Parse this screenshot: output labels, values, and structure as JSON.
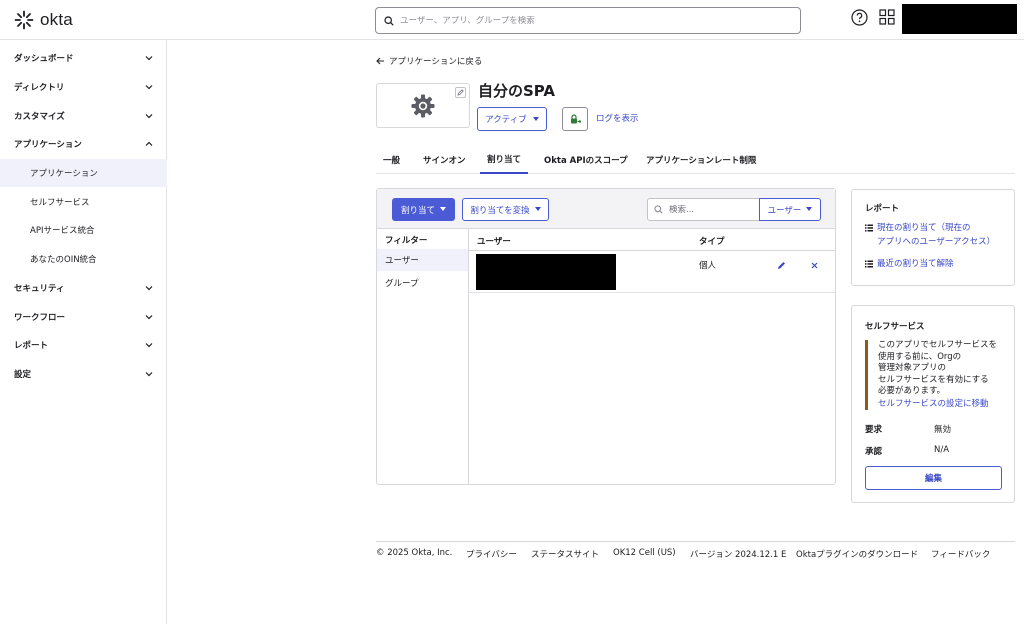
{
  "brand": {
    "name": "okta"
  },
  "header": {
    "search_placeholder": "ユーザー、アプリ、グループを検索"
  },
  "sidebar": {
    "items": [
      {
        "label": "ダッシュボード"
      },
      {
        "label": "ディレクトリ"
      },
      {
        "label": "カスタマイズ"
      },
      {
        "label": "アプリケーション",
        "expanded": true
      },
      {
        "label": "セキュリティ"
      },
      {
        "label": "ワークフロー"
      },
      {
        "label": "レポート"
      },
      {
        "label": "設定"
      }
    ],
    "sub_items": [
      {
        "label": "アプリケーション",
        "active": true
      },
      {
        "label": "セルフサービス"
      },
      {
        "label": "APIサービス統合"
      },
      {
        "label": "あなたのOIN統合"
      }
    ]
  },
  "main": {
    "back_link": "アプリケーションに戻る",
    "app_title": "自分のSPA",
    "status_label": "アクティブ",
    "log_link": "ログを表示",
    "tabs": [
      {
        "label": "一般"
      },
      {
        "label": "サインオン"
      },
      {
        "label": "割り当て",
        "active": true
      },
      {
        "label": "Okta APIのスコープ"
      },
      {
        "label": "アプリケーションレート制限"
      }
    ],
    "toolbar": {
      "assign_label": "割り当て",
      "convert_label": "割り当てを変換",
      "search_placeholder": "検索...",
      "scope_label": "ユーザー"
    },
    "filter": {
      "heading": "フィルター",
      "items": [
        {
          "label": "ユーザー",
          "active": true
        },
        {
          "label": "グループ"
        }
      ]
    },
    "table": {
      "headers": {
        "user": "ユーザー",
        "type": "タイプ"
      },
      "rows": [
        {
          "type": "個人"
        }
      ]
    }
  },
  "reports_card": {
    "title": "レポート",
    "link1_line1": "現在の割り当て（現在の",
    "link1_line2": "アプリへのユーザーアクセス）",
    "link2": "最近の割り当て解除"
  },
  "self_service_card": {
    "title": "セルフサービス",
    "notice_lines": [
      "このアプリでセルフサービスを",
      "使用する前に、Orgの",
      "管理対象アプリの",
      "セルフサービスを有効にする",
      "必要があります。"
    ],
    "notice_link": "セルフサービスの設定に移動",
    "request_key": "要求",
    "request_value": "無効",
    "approval_key": "承認",
    "approval_value": "N/A",
    "edit_label": "編集"
  },
  "footer": {
    "copyright": "© 2025 Okta, Inc.",
    "privacy": "プライバシー",
    "status_site": "ステータスサイト",
    "cell": "OK12 Cell (US)",
    "version": "バージョン 2024.12.1 E",
    "plugin": "Oktaプラグインのダウンロード",
    "feedback": "フィードバック"
  },
  "colors": {
    "accent": "#4b5bd6",
    "callout_border": "#8a5a1e"
  }
}
